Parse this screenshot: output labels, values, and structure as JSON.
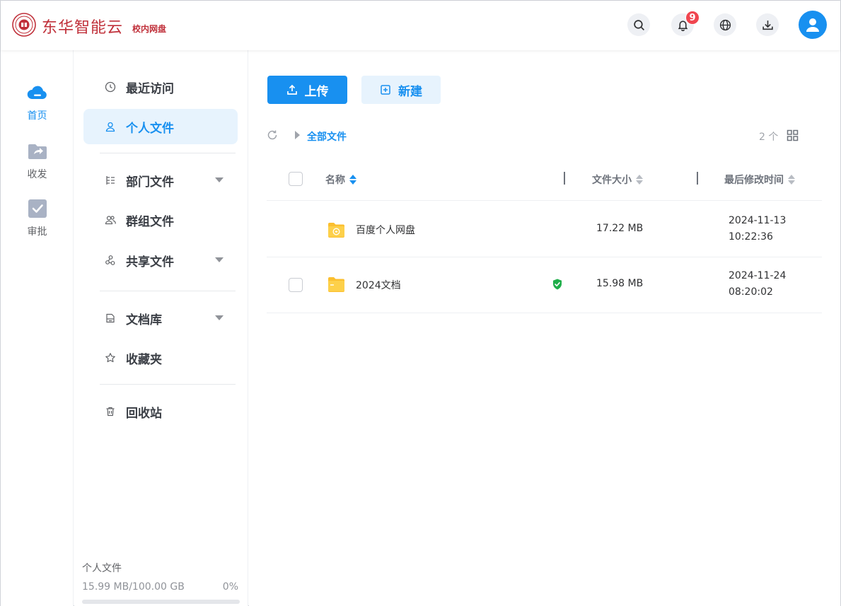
{
  "header": {
    "brand_name": "东华智能云",
    "brand_sub": "校内网盘",
    "notification_count": "9",
    "colors": {
      "brand": "#c0303a",
      "accent": "#1890f0",
      "badge": "#f0454f"
    },
    "icons": [
      "search-icon",
      "bell-icon",
      "globe-icon",
      "download-icon",
      "user-icon"
    ]
  },
  "rail": {
    "items": [
      {
        "label": "首页",
        "icon": "cloud-icon",
        "active": true
      },
      {
        "label": "收发",
        "icon": "share-folder-icon",
        "active": false
      },
      {
        "label": "审批",
        "icon": "approval-check-icon",
        "active": false
      }
    ]
  },
  "sidebar": {
    "items": [
      {
        "label": "最近访问",
        "icon": "clock-icon"
      },
      {
        "label": "个人文件",
        "icon": "person-icon",
        "active": true
      },
      {
        "label": "部门文件",
        "icon": "tree-icon",
        "expandable": true
      },
      {
        "label": "群组文件",
        "icon": "group-icon"
      },
      {
        "label": "共享文件",
        "icon": "share-icon",
        "expandable": true
      },
      {
        "label": "文档库",
        "icon": "library-icon",
        "expandable": true
      },
      {
        "label": "收藏夹",
        "icon": "star-icon"
      },
      {
        "label": "回收站",
        "icon": "trash-icon"
      }
    ],
    "quota": {
      "label": "个人文件",
      "text": "15.99 MB/100.00 GB",
      "percent": "0%",
      "fill_fraction": 0.0002
    }
  },
  "toolbar": {
    "upload_label": "上传",
    "new_label": "新建"
  },
  "breadcrumb": {
    "root": "全部文件"
  },
  "list": {
    "count": "2 个",
    "columns": {
      "name": "名称",
      "size": "文件大小",
      "modified": "最后修改时间"
    },
    "rows": [
      {
        "name": "百度个人网盘",
        "size": "17.22 MB",
        "date": "2024-11-13",
        "time": "10:22:36",
        "icon": "cloud-folder-icon",
        "secured": false,
        "checkbox_visible": false
      },
      {
        "name": "2024文档",
        "size": "15.98 MB",
        "date": "2024-11-24",
        "time": "08:20:02",
        "icon": "folder-icon",
        "secured": true,
        "checkbox_visible": true
      }
    ]
  }
}
